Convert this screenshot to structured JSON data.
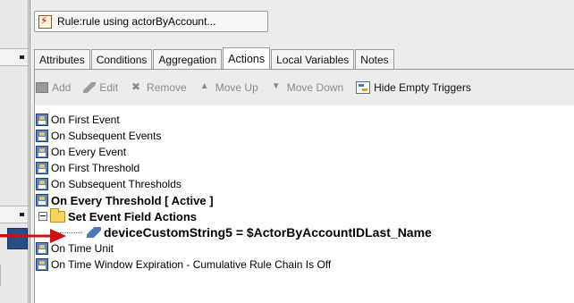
{
  "window": {
    "title": "Rule:rule using actorByAccount..."
  },
  "tabs": [
    {
      "label": "Attributes",
      "active": false
    },
    {
      "label": "Conditions",
      "active": false
    },
    {
      "label": "Aggregation",
      "active": false
    },
    {
      "label": "Actions",
      "active": true
    },
    {
      "label": "Local Variables",
      "active": false
    },
    {
      "label": "Notes",
      "active": false
    }
  ],
  "toolbar": {
    "add_label": "Add",
    "edit_label": "Edit",
    "remove_label": "Remove",
    "move_up_label": "Move Up",
    "move_down_label": "Move Down",
    "hide_empty_label": "Hide Empty Triggers"
  },
  "triggers": {
    "t1": "On First Event",
    "t2": "On Subsequent Events",
    "t3": "On Every Event",
    "t4": "On First Threshold",
    "t5": "On Subsequent Thresholds",
    "t6": "On Every Threshold [ Active ]",
    "folder": "Set Event Field Actions",
    "action": "deviceCustomString5 = $ActorByAccountIDLast_Name",
    "t7": "On Time Unit",
    "t8": "On Time Window Expiration - Cumulative Rule Chain Is Off"
  },
  "colors": {
    "pointer_arrow": "#cc1111",
    "trigger_icon": "#5d86c9",
    "folder_icon": "#f6d55a"
  }
}
